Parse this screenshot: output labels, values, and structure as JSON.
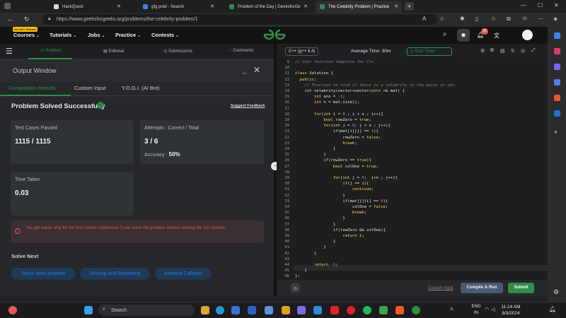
{
  "browser": {
    "tabs": [
      {
        "title": "HackQuest",
        "active": false
      },
      {
        "title": "gfg potd - Search",
        "active": false
      },
      {
        "title": "Problem of the Day | GeeksforGe",
        "active": false
      },
      {
        "title": "The Celebrity Problem | Practice",
        "active": true
      }
    ],
    "url": "https://www.geeksforgeeks.org/problems/the-celebrity-problem/1",
    "notification_count": "25"
  },
  "site": {
    "refund_badge": "Get 90% Refund",
    "menu": [
      "Courses",
      "Tutorials",
      "Jobs",
      "Practice",
      "Contests"
    ],
    "logo": "GG"
  },
  "left_tabs": [
    "Problem",
    "Editorial",
    "Submissions",
    "Comments"
  ],
  "output": {
    "title": "Output Window",
    "tabs": [
      "Compilation Results",
      "Custom Input",
      "Y.O.G.I. (AI Bot)"
    ],
    "status": "Problem Solved Successfully",
    "feedback_link": "Suggest Feedback",
    "test_cases_label": "Test Cases Passed",
    "test_cases_value": "1115 / 1115",
    "attempts_label": "Attempts : Correct / Total",
    "attempts_value": "3 / 6",
    "accuracy_label": "Accuracy :",
    "accuracy_value": "50%",
    "time_label": "Time Taken",
    "time_value": "0.03",
    "warning": "You get marks only for the first correct submission if you solve the problem without viewing the full solution.",
    "solve_next_title": "Solve Next",
    "solve_next": [
      "Stock span problem",
      "Missing And Repeating",
      "Asteroid Collision"
    ]
  },
  "editor": {
    "language": "C++ (g++ 5.4)",
    "average_time": "Average Time: 30m",
    "timer_label": "Start Timer",
    "line_numbers": [
      "9",
      "10",
      "11",
      "12",
      "13",
      "14",
      "15",
      "16",
      "17",
      "18",
      "19",
      "20",
      "21",
      "22",
      "23",
      "24",
      "25",
      "26",
      "27",
      "28",
      "29",
      "30",
      "31",
      "32",
      "33",
      "34",
      "35",
      "36",
      "37",
      "38",
      "39",
      "40",
      "41",
      "42",
      "43",
      "44",
      "45",
      "46"
    ],
    "code_lines": [
      "// User function template for C++",
      "",
      "class Solution {",
      "  public:",
      "    // Function to find if there is a celebrity in the party or not.",
      "    int celebrity(vector<vector<int> >& mat) {",
      "        int ans = -1;",
      "        int n = mat.size();",
      "",
      "        for(int i = 0 ; i < n ; i++){",
      "            bool rowZero = true;",
      "            for(int j = 0; j < n ; j++){",
      "                if(mat[i][j] == 1){",
      "                    rowZero = false;",
      "                    break;",
      "                }",
      "            }",
      "            if(rowZero == true){",
      "                bool colOne = true;",
      "",
      "                for(int j = 0;  j<n ; j++){",
      "                    if(j == i){",
      "                        continue;",
      "                    }",
      "                    if(mat[j][i] == 0){",
      "                        colOne = false;",
      "                        break;",
      "                    }",
      "                }",
      "                if(rowZero && colOne){",
      "                    return i;",
      "                }",
      "            }",
      "        }",
      "",
      "        return -1;",
      "    }",
      "};"
    ],
    "custom_input": "Custom Input",
    "compile_label": "Compile & Run",
    "submit_label": "Submit"
  },
  "taskbar": {
    "search_placeholder": "Search",
    "lang": "ENG",
    "region": "IN",
    "time": "11:14 AM",
    "date": "8/3/2024"
  },
  "colors": {
    "accent_green": "#2f8d46",
    "error_red": "#e2584f",
    "chip_blue": "#2b7bd3"
  }
}
